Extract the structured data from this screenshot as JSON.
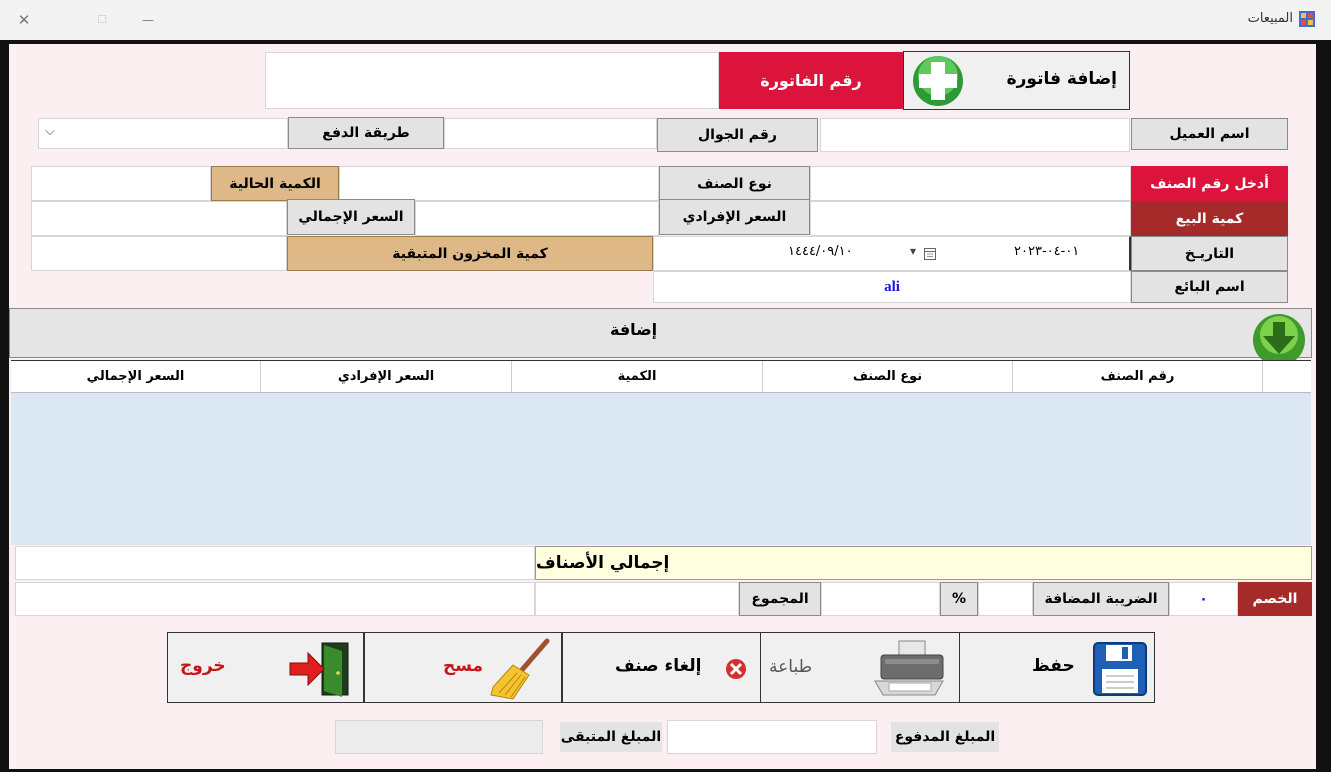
{
  "window": {
    "title": "المبيعات",
    "close_glyph": "✕",
    "maximize_glyph": "☐",
    "minimize_glyph": "—"
  },
  "header": {
    "add_invoice": "إضافة فاتورة",
    "invoice_number_label": "رقم الفاتورة",
    "invoice_number_value": ""
  },
  "customer": {
    "name_label": "اسم العميل",
    "name_value": "",
    "mobile_label": "رقم الجوال",
    "mobile_value": "",
    "payment_label": "طريقة الدفع",
    "payment_value": "",
    "payment_arrow": "⌵"
  },
  "item": {
    "enter_code_label": "أدخل رقم الصنف",
    "code_value": "",
    "type_label": "نوع الصنف",
    "type_value": "",
    "current_qty_label": "الكمية الحالية",
    "current_qty_value": "",
    "sale_qty_label": "كمية البيع",
    "sale_qty_value": "",
    "unit_price_label": "السعر الإفرادي",
    "unit_price_value": "",
    "total_price_label": "السعر الإجمالي",
    "total_price_value": "",
    "date_label": "التاريـخ",
    "date_gregorian": "٠١-٠٤-٢٠٢٣",
    "date_hijri": "١٤٤٤/٠٩/١٠",
    "date_dropdown": "▾",
    "remaining_stock_label": "كمية المخزون المتبقية",
    "remaining_stock_value": "",
    "seller_label": "اسم البائع",
    "seller_value": "ali"
  },
  "add_section": {
    "label": "إضافة"
  },
  "grid": {
    "columns": [
      "رقم الصنف",
      "نوع الصنف",
      "الكمية",
      "السعر الإفرادي",
      "السعر الإجمالي"
    ]
  },
  "totals": {
    "items_total_label": "إجمالي الأصناف",
    "items_total_value": "",
    "discount_label": "الخصم",
    "discount_value": "٠",
    "vat_label": "الضريبة المضافة",
    "vat_value": "",
    "percent": "%",
    "percent_value": "",
    "sum_label": "المجموع",
    "sum_value": "",
    "grand_value": ""
  },
  "actions": {
    "save": "حفظ",
    "print": "طباعة",
    "cancel_item": "إلغاء صنف",
    "clear": "مسح",
    "exit": "خروج"
  },
  "payment": {
    "paid_label": "المبلغ المدفوع",
    "paid_value": "",
    "remaining_label": "المبلغ المتبقى",
    "remaining_value": ""
  },
  "colors": {
    "accent_red": "#dc143c",
    "dark_red": "#a52a2a",
    "tan": "#deb887",
    "grid_bg": "#dbe7f3",
    "client_bg": "#fbeff1"
  }
}
